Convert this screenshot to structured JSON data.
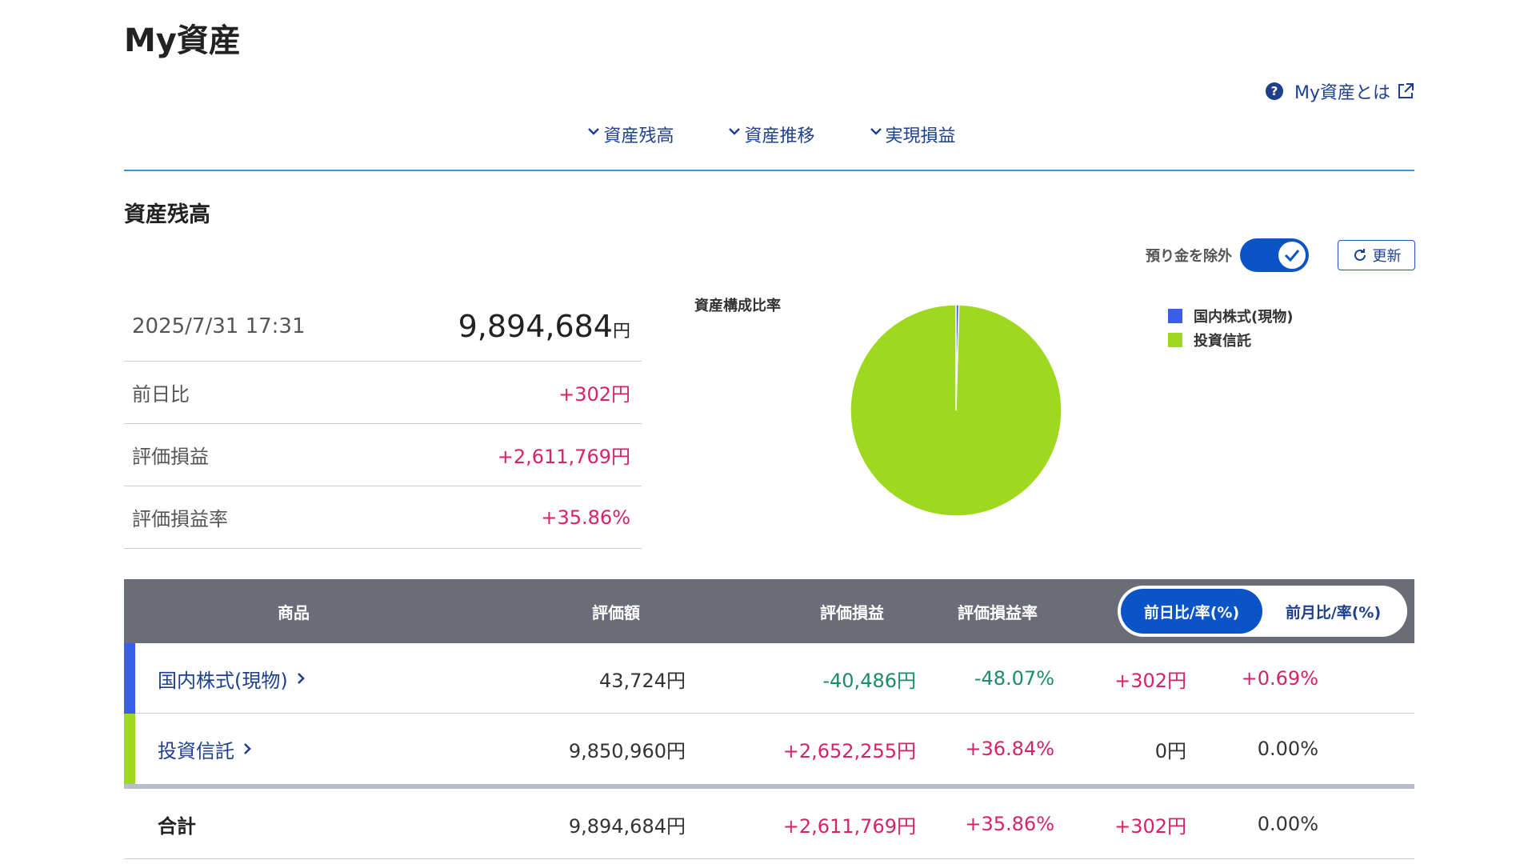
{
  "page": {
    "title": "My資産"
  },
  "help": {
    "label": "My資産とは"
  },
  "nav": {
    "items": [
      "資産残高",
      "資産推移",
      "実現損益"
    ]
  },
  "section": {
    "title": "資産残高"
  },
  "toggle": {
    "label": "預り金を除外",
    "checked": true
  },
  "refresh": {
    "label": "更新"
  },
  "summary": {
    "date": "2025/7/31 17:31",
    "total": "9,894,684",
    "total_unit": "円",
    "rows": [
      {
        "label": "前日比",
        "value": "+302円"
      },
      {
        "label": "評価損益",
        "value": "+2,611,769円"
      },
      {
        "label": "評価損益率",
        "value": "+35.86%"
      }
    ]
  },
  "chart_data": {
    "type": "pie",
    "title": "資産構成比率",
    "legend_position": "right",
    "slices": [
      {
        "label": "国内株式(現物)",
        "value": 43724,
        "color": "#3b5ee8"
      },
      {
        "label": "投資信託",
        "value": 9850960,
        "color": "#9fd91f"
      }
    ]
  },
  "table": {
    "headers": {
      "product": "商品",
      "valuation": "評価額",
      "pl": "評価損益",
      "pl_rate": "評価損益率"
    },
    "segment": {
      "active": "前日比/率(%)",
      "inactive": "前月比/率(%)"
    },
    "rows": [
      {
        "name": "国内株式(現物)",
        "color": "#3b5ee8",
        "valuation": "43,724円",
        "pl": "-40,486円",
        "pl_rate": "-48.07%",
        "diff": "+302円",
        "diff_rate": "+0.69%"
      },
      {
        "name": "投資信託",
        "color": "#9fd91f",
        "valuation": "9,850,960円",
        "pl": "+2,652,255円",
        "pl_rate": "+36.84%",
        "diff": "0円",
        "diff_rate": "0.00%"
      }
    ],
    "total": {
      "label": "合計",
      "valuation": "9,894,684円",
      "pl": "+2,611,769円",
      "pl_rate": "+35.86%",
      "diff": "+302円",
      "diff_rate": "0.00%"
    }
  }
}
